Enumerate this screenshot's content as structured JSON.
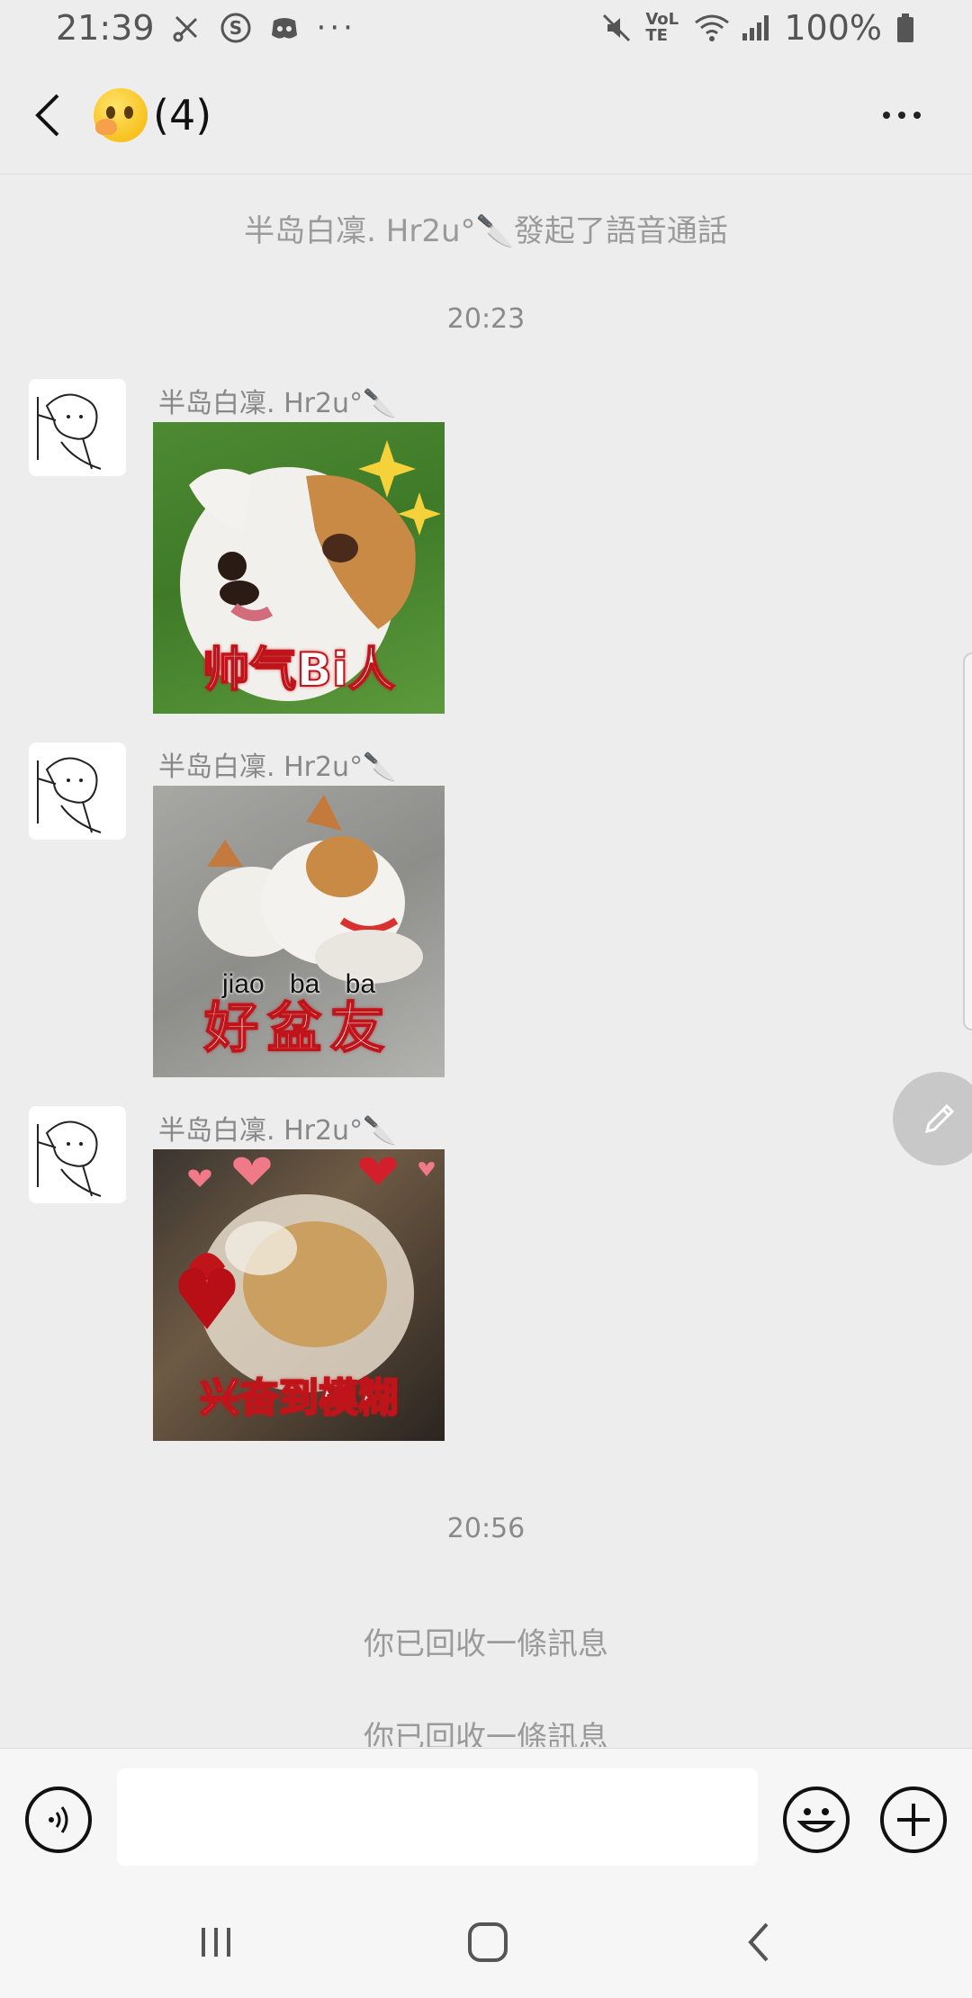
{
  "status_bar": {
    "time": "21:39",
    "notification_icons": [
      "scissors-icon",
      "s-app-icon",
      "discord-icon"
    ],
    "more_dots": "···",
    "battery": "100%",
    "network": "VoLTE"
  },
  "header": {
    "title_count": "(4)",
    "title_emoji": "face-with-hand-icon"
  },
  "messages": {
    "system_call": "半岛白凜. Hr2u°🔪發起了語音通話",
    "time_1": "20:23",
    "sender_name": "半岛白凜. Hr2u°🔪",
    "stickers": [
      {
        "caption": "帅气Bi人",
        "pinyin": ""
      },
      {
        "caption": "好盆友",
        "pinyin": "jiao ba ba"
      },
      {
        "caption": "兴奋到模糊",
        "pinyin": ""
      }
    ],
    "time_2": "20:56",
    "recalled_1": "你已回收一條訊息",
    "recalled_2": "你已回收一條訊息"
  },
  "input": {
    "placeholder": ""
  },
  "colors": {
    "background": "#ededed",
    "caption_red": "#c0141b"
  }
}
